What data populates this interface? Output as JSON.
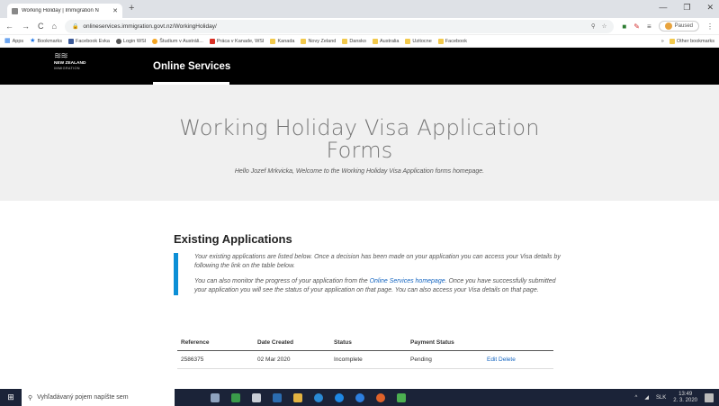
{
  "browser": {
    "tab_title": "Working Holiday | Immigration N",
    "new_tab": "+",
    "url": "onlineservices.immigration.govt.nz/WorkingHoliday/",
    "profile_status": "Paused",
    "window_controls": [
      "—",
      "❐",
      "✕"
    ]
  },
  "bookmarks": [
    {
      "label": "Apps",
      "icon": "apps-icon"
    },
    {
      "label": "Bookmarks",
      "icon": "star-icon"
    },
    {
      "label": "Facebook Evka",
      "icon": "facebook-icon"
    },
    {
      "label": "Login WSI",
      "icon": "gear-icon"
    },
    {
      "label": "Študium v Austráli...",
      "icon": "sun-icon"
    },
    {
      "label": "Práca v Kanade, WSI",
      "icon": "maple-leaf-icon"
    },
    {
      "label": "Kanada",
      "icon": "folder-icon"
    },
    {
      "label": "Novy Zeland",
      "icon": "folder-icon"
    },
    {
      "label": "Dansko",
      "icon": "folder-icon"
    },
    {
      "label": "Australia",
      "icon": "folder-icon"
    },
    {
      "label": "Uzitocne",
      "icon": "folder-icon"
    },
    {
      "label": "Facebook",
      "icon": "folder-icon"
    }
  ],
  "other_bookmarks": "Other bookmarks",
  "site": {
    "logo_line1": "NEW ZEALAND",
    "logo_line2": "IMMIGRATION",
    "nav_label": "Online Services"
  },
  "hero": {
    "title": "Working Holiday Visa Application Forms",
    "welcome": "Hello Jozef Mrkvicka, Welcome to the Working Holiday Visa Application forms homepage."
  },
  "existing": {
    "heading": "Existing Applications",
    "para1": "Your existing applications are listed below. Once a decision has been made on your application you can access your Visa details by following the link on the table below.",
    "para2_before": "You can also monitor the progress of your application from the ",
    "para2_link": "Online Services homepage",
    "para2_after": ". Once you have successfully submitted your application you will see the status of your application on that page. You can also access your Visa details on that page."
  },
  "table": {
    "headers": [
      "Reference",
      "Date Created",
      "Status",
      "Payment Status",
      ""
    ],
    "rows": [
      {
        "reference": "2586375",
        "date": "02 Mar 2020",
        "status": "Incomplete",
        "payment": "Pending",
        "edit": "Edit",
        "delete": "Delete"
      }
    ]
  },
  "taskbar": {
    "search_placeholder": "Vyhľadávaný pojem napíšte sem",
    "language": "SLK",
    "time": "13:49",
    "date": "2. 3. 2020",
    "app_colors": [
      "#8fa3bf",
      "#3a9a4a",
      "#c9ced6",
      "#2b6cb0",
      "#e3b341",
      "#2a8ad4",
      "#1e88e5",
      "#2d7fe0",
      "#e0622a",
      "#4caf50"
    ]
  }
}
